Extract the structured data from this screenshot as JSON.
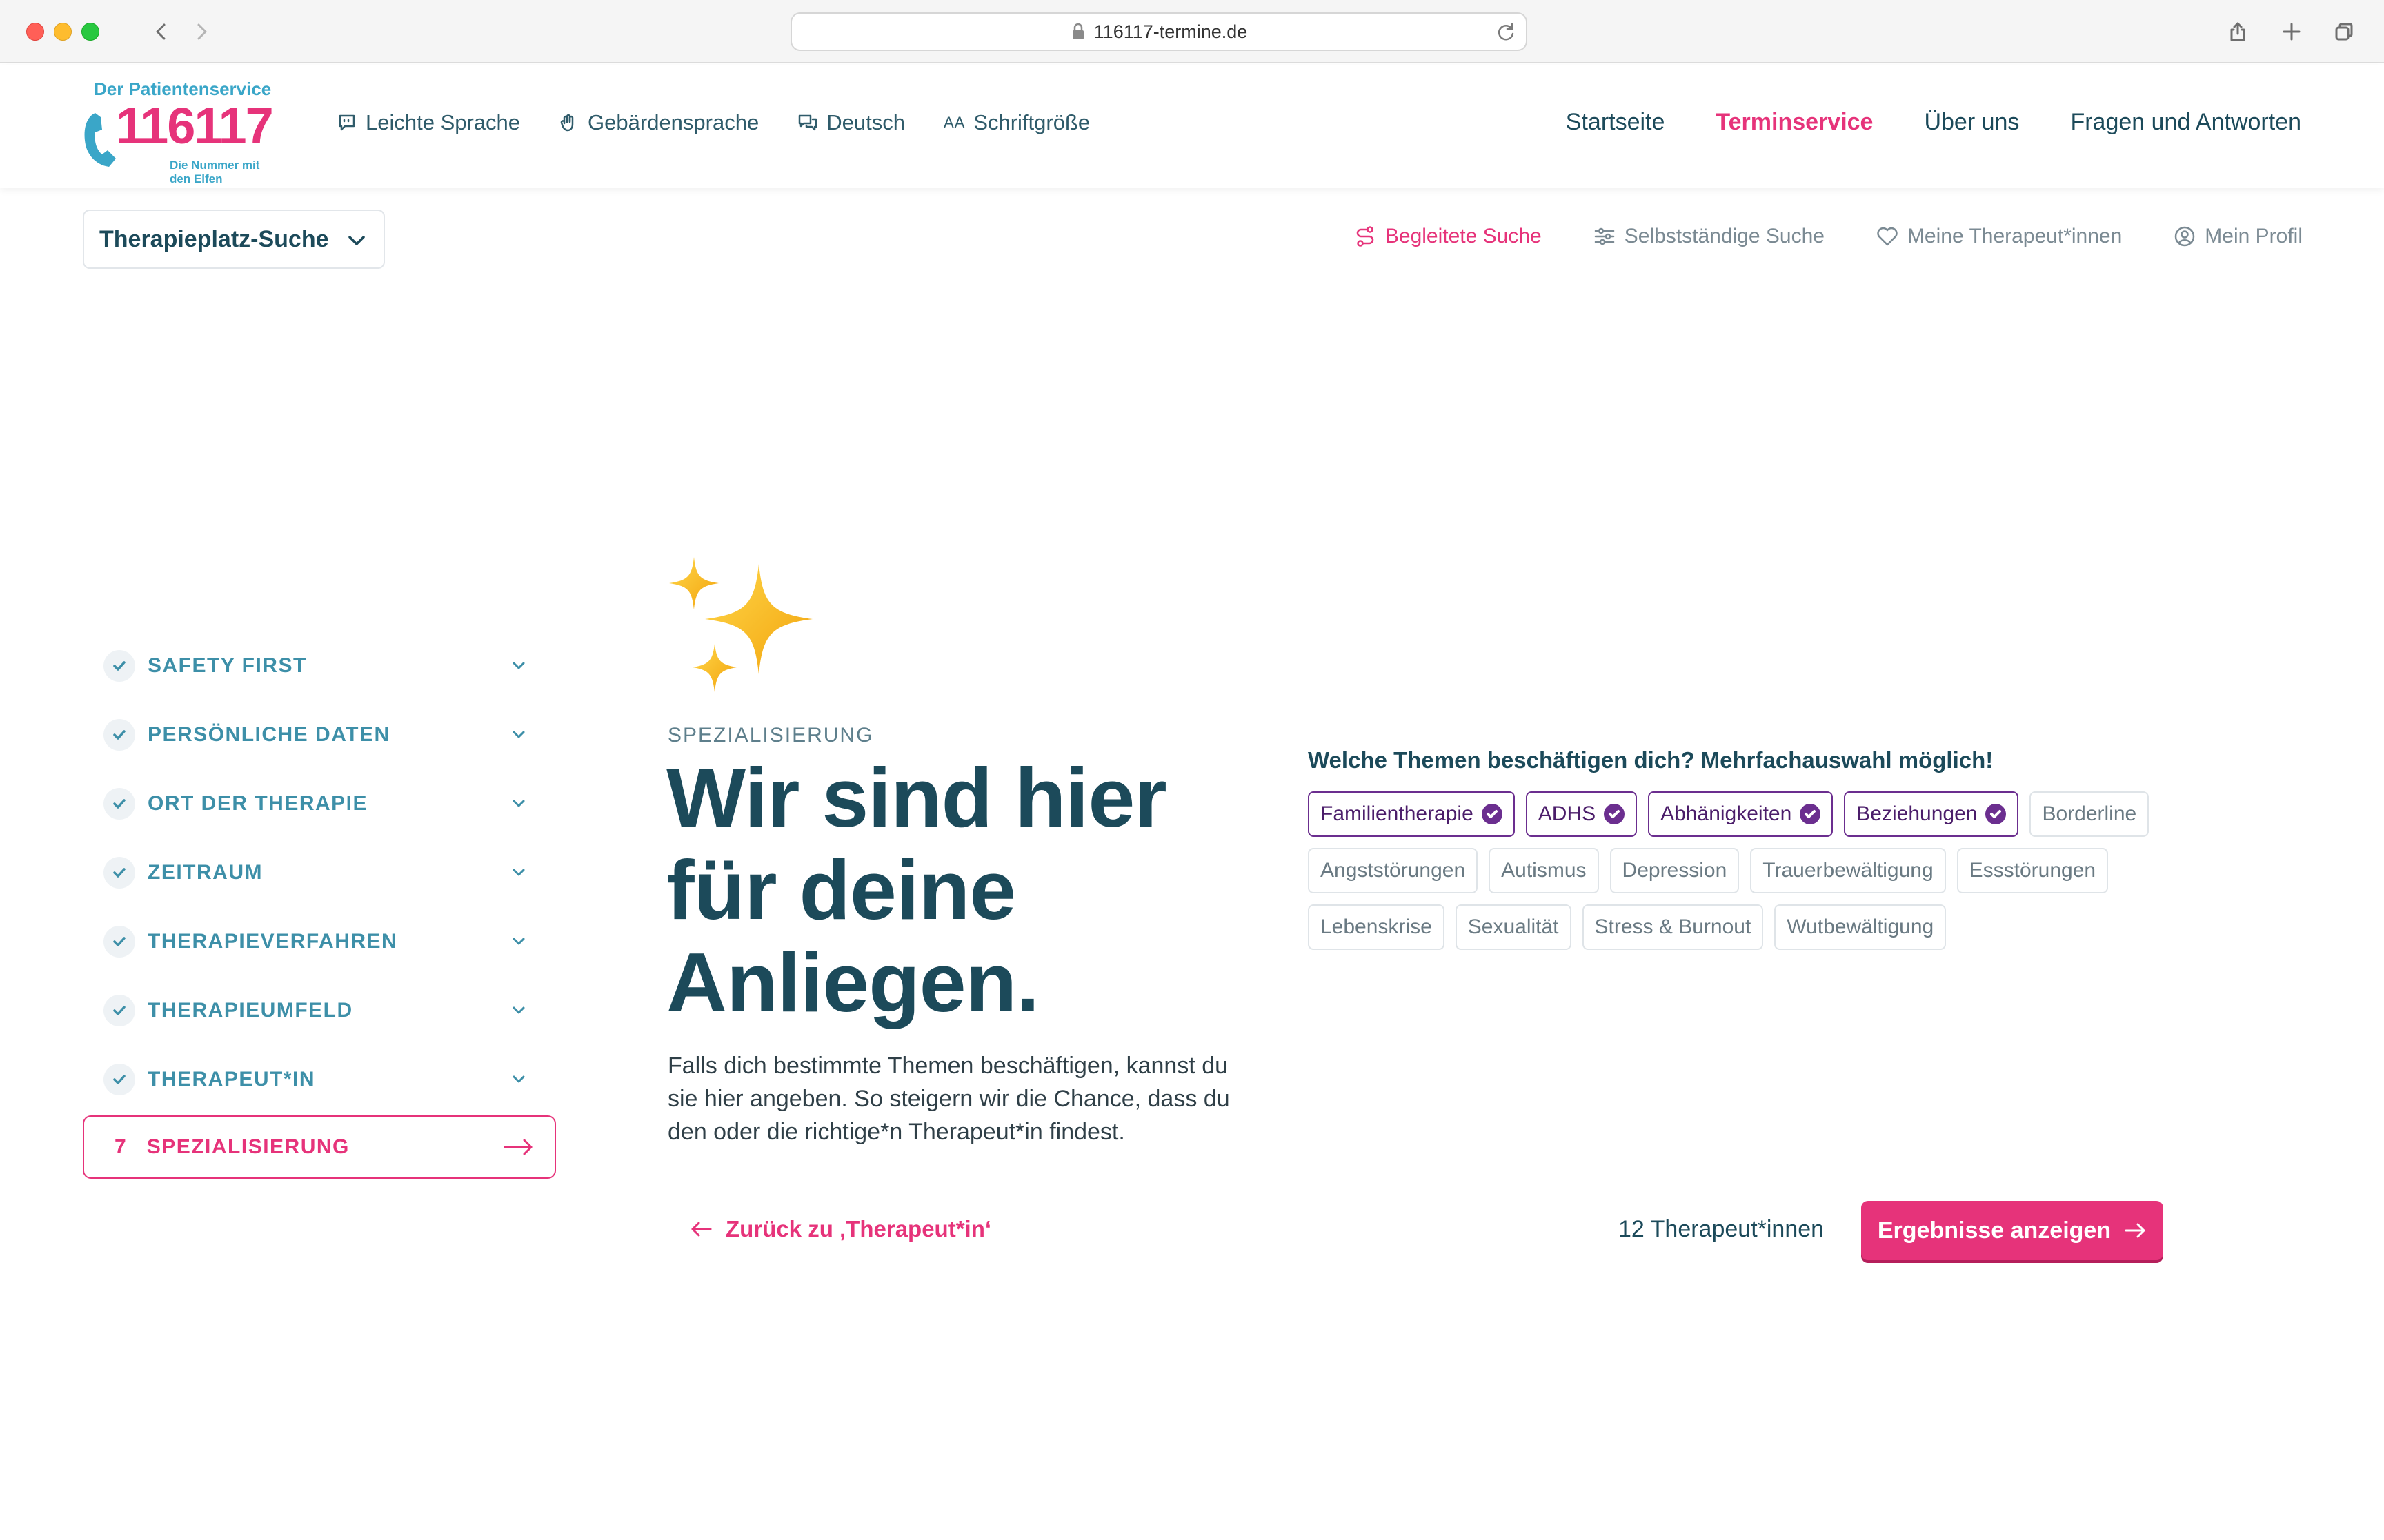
{
  "browser": {
    "url": "116117-termine.de"
  },
  "header": {
    "logo": {
      "tagline_top": "Der Patientenservice",
      "number": "116117",
      "tagline_bottom": "Die Nummer mit den Elfen"
    },
    "utility_nav": [
      {
        "label": "Leichte Sprache",
        "icon": "speech-bubble-icon"
      },
      {
        "label": "Gebärdensprache",
        "icon": "hand-icon"
      },
      {
        "label": "Deutsch",
        "icon": "chat-bubbles-icon"
      },
      {
        "label": "Schriftgröße",
        "icon": "font-size-icon",
        "glyph": "AA"
      }
    ],
    "main_nav": [
      {
        "label": "Startseite"
      },
      {
        "label": "Terminservice",
        "active": true
      },
      {
        "label": "Über uns"
      },
      {
        "label": "Fragen und Antworten"
      }
    ]
  },
  "subheader": {
    "search_select": "Therapieplatz-Suche",
    "nav": [
      {
        "label": "Begleitete Suche",
        "icon": "route-icon",
        "active": true
      },
      {
        "label": "Selbstständige Suche",
        "icon": "sliders-icon"
      },
      {
        "label": "Meine Therapeut*innen",
        "icon": "heart-icon"
      },
      {
        "label": "Mein Profil",
        "icon": "user-circle-icon"
      }
    ]
  },
  "steps": {
    "completed": [
      {
        "label": "SAFETY FIRST"
      },
      {
        "label": "PERSÖNLICHE DATEN"
      },
      {
        "label": "ORT DER THERAPIE"
      },
      {
        "label": "ZEITRAUM"
      },
      {
        "label": "THERAPIEVERFAHREN"
      },
      {
        "label": "THERAPIEUMFELD"
      },
      {
        "label": "THERAPEUT*IN"
      }
    ],
    "active": {
      "number": "7",
      "label": "SPEZIALISIERUNG"
    }
  },
  "main": {
    "eyebrow": "SPEZIALISIERUNG",
    "headline_lines": [
      "Wir sind hier",
      "für deine",
      "Anliegen."
    ],
    "body": "Falls dich bestimmte Themen beschäftigen, kannst du sie hier angeben. So steigern wir die Chance, dass du den oder die richtige*n Therapeut*in findest.",
    "back_link": "Zurück zu ‚Therapeut*in‘"
  },
  "topics": {
    "question": "Welche Themen beschäftigen dich? Mehrfachauswahl möglich!",
    "chips": [
      {
        "label": "Familientherapie",
        "selected": true
      },
      {
        "label": "ADHS",
        "selected": true
      },
      {
        "label": "Abhänigkeiten",
        "selected": true
      },
      {
        "label": "Beziehungen",
        "selected": true
      },
      {
        "label": "Borderline",
        "selected": false
      },
      {
        "label": "Angststörungen",
        "selected": false
      },
      {
        "label": "Autismus",
        "selected": false
      },
      {
        "label": "Depression",
        "selected": false
      },
      {
        "label": "Trauerbewältigung",
        "selected": false
      },
      {
        "label": "Essstörungen",
        "selected": false
      },
      {
        "label": "Lebenskrise",
        "selected": false
      },
      {
        "label": "Sexualität",
        "selected": false
      },
      {
        "label": "Stress & Burnout",
        "selected": false
      },
      {
        "label": "Wutbewältigung",
        "selected": false
      }
    ]
  },
  "results": {
    "count_label": "12 Therapeut*innen",
    "button_label": "Ergebnisse anzeigen"
  },
  "colors": {
    "brand_pink": "#e6337a",
    "brand_teal": "#1c4a5a",
    "step_teal": "#3d8fa8",
    "chip_selected": "#6b2e8f",
    "sparkle_gold": "#f5b81c"
  }
}
